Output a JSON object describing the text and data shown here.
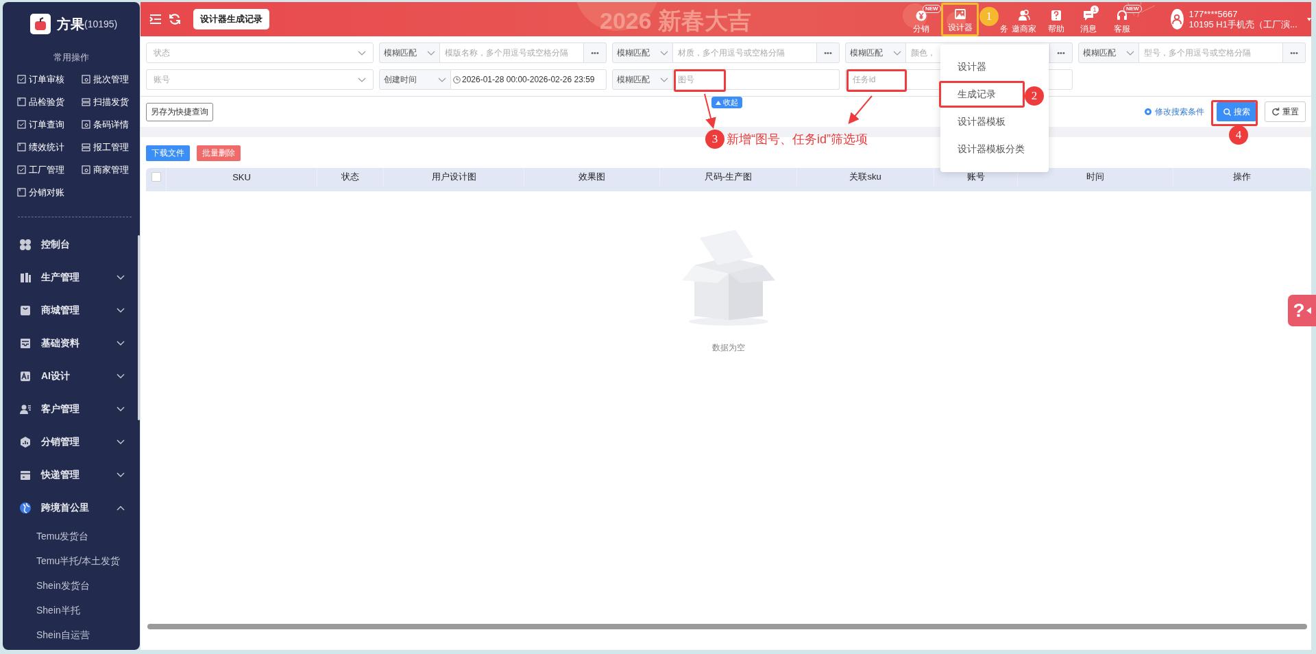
{
  "sidebar": {
    "brand": "方果",
    "brand_id": "(10195)",
    "quick_title": "常用操作",
    "quick_ops": [
      "订单审核",
      "批次管理",
      "品检验货",
      "扫描发货",
      "订单查询",
      "条码详情",
      "绩效统计",
      "报工管理",
      "工厂管理",
      "商家管理",
      "分销对账"
    ],
    "menu": [
      {
        "label": "控制台",
        "kind": "link"
      },
      {
        "label": "生产管理",
        "kind": "group",
        "expanded": false
      },
      {
        "label": "商城管理",
        "kind": "group",
        "expanded": false
      },
      {
        "label": "基础资料",
        "kind": "group",
        "expanded": false
      },
      {
        "label": "AI设计",
        "kind": "group",
        "expanded": false
      },
      {
        "label": "客户管理",
        "kind": "group",
        "expanded": false
      },
      {
        "label": "分销管理",
        "kind": "group",
        "expanded": false
      },
      {
        "label": "快递管理",
        "kind": "group",
        "expanded": false
      },
      {
        "label": "跨境首公里",
        "kind": "group",
        "expanded": true,
        "children": [
          "Temu发货台",
          "Temu半托/本土发货",
          "Shein发货台",
          "Shein半托",
          "Shein自运营"
        ]
      }
    ]
  },
  "topbar": {
    "page_tab": "设计器生成记录",
    "banner": "2026 新春大吉",
    "nav": [
      {
        "label": "分销",
        "badge": "NEW"
      },
      {
        "label": "设计器"
      },
      {
        "label": "务"
      },
      {
        "label": "邀商家"
      },
      {
        "label": "帮助"
      },
      {
        "label": "消息",
        "badge": "1"
      },
      {
        "label": "客服",
        "badge": "NEW"
      }
    ],
    "user": {
      "phone": "177****5667",
      "org": "10195  H1手机壳（工厂演..."
    }
  },
  "filters": {
    "rows": [
      [
        {
          "kind": "select",
          "placeholder": "状态"
        },
        {
          "kind": "match",
          "mode": "模糊匹配",
          "placeholder": "模版名称，多个用逗号或空格分隔",
          "more": "•••"
        },
        {
          "kind": "match",
          "mode": "模糊匹配",
          "placeholder": "材质，多个用逗号或空格分隔",
          "more": "•••"
        },
        {
          "kind": "match",
          "mode": "模糊匹配",
          "placeholder": "颜色，",
          "more": "•••"
        },
        {
          "kind": "match",
          "mode": "模糊匹配",
          "placeholder": "型号，多个用逗号或空格分隔",
          "more": "•••"
        }
      ],
      [
        {
          "kind": "select",
          "placeholder": "账号"
        },
        {
          "kind": "date",
          "mode": "创建时间",
          "value": "2026-01-28 00:00-2026-02-26 23:59"
        },
        {
          "kind": "match",
          "mode": "模糊匹配",
          "placeholder": "图号"
        },
        {
          "kind": "input",
          "placeholder": "任务id"
        }
      ]
    ],
    "collapse": "收起",
    "save_query": "另存为快捷查询",
    "edit_conditions": "修改搜索条件",
    "search": "搜索",
    "reset": "重置"
  },
  "dropdown": [
    "设计器",
    "生成记录",
    "设计器模板",
    "设计器模板分类"
  ],
  "actions": [
    {
      "label": "下载文件",
      "kind": "primary"
    },
    {
      "label": "批量删除",
      "kind": "danger"
    }
  ],
  "table": {
    "select_all": {
      "checked": false
    },
    "columns": [
      "SKU",
      "状态",
      "用户设计图",
      "效果图",
      "尺码-生产图",
      "关联sku",
      "账号",
      "时间",
      "操作"
    ],
    "empty": "数据为空"
  },
  "annotations": {
    "steps": [
      {
        "number": "1",
        "color": "#f5b82e"
      },
      {
        "number": "2",
        "color": "#ee3b3b"
      },
      {
        "number": "3",
        "color": "#ee3b3b"
      },
      {
        "number": "4",
        "color": "#ee3b3b"
      }
    ],
    "note": "新增“图号、任务id”筛选项"
  },
  "help_float": "?"
}
